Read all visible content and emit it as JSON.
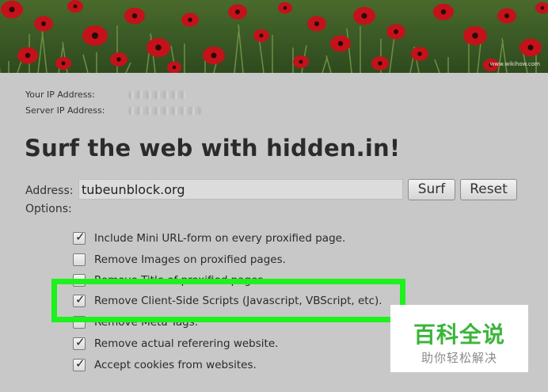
{
  "banner": {
    "url_text": "www.wikihow.com"
  },
  "info": {
    "your_ip_label": "Your IP Address:",
    "server_ip_label": "Server IP Address:"
  },
  "title": "Surf the web with hidden.in!",
  "form": {
    "address_label": "Address:",
    "address_value": "tubeunblock.org",
    "surf_label": "Surf",
    "reset_label": "Reset",
    "options_label": "Options:"
  },
  "options": [
    {
      "label": "Include Mini URL-form on every proxified page.",
      "checked": true
    },
    {
      "label": "Remove Images on proxified pages.",
      "checked": false
    },
    {
      "label": "Remove Title of proxified pages.",
      "checked": false
    },
    {
      "label": "Remove Client-Side Scripts (Javascript, VBScript, etc).",
      "checked": true
    },
    {
      "label": "Remove Meta Tags.",
      "checked": false
    },
    {
      "label": "Remove actual referering website.",
      "checked": true
    },
    {
      "label": "Accept cookies from websites.",
      "checked": true
    }
  ],
  "watermark": {
    "main": "百科全说",
    "sub": "助你轻松解决"
  },
  "colors": {
    "highlight": "#1df21d",
    "watermark_green": "#3bb53b",
    "page_bg": "#c8c8c8"
  }
}
